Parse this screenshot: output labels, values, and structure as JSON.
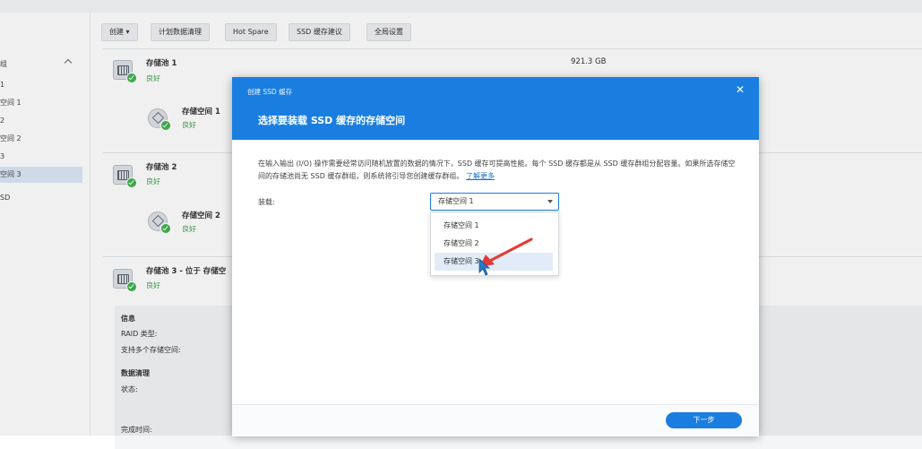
{
  "sidebar": {
    "items": [
      {
        "label": "组"
      },
      {
        "label": "1"
      },
      {
        "label": "空间 1"
      },
      {
        "label": "2"
      },
      {
        "label": "空间 2"
      },
      {
        "label": "3"
      },
      {
        "label": "空间 3"
      },
      {
        "label": "SD"
      }
    ]
  },
  "toolbar": {
    "create_label": "创建 ▾",
    "schedule_label": "计划数据清理",
    "hotspare_label": "Hot Spare",
    "ssd_advice_label": "SSD 缓存建议",
    "global_label": "全局设置"
  },
  "pools": [
    {
      "name": "存储池 1",
      "status": "良好",
      "size": "921.3 GB",
      "volume": {
        "name": "存储空间 1",
        "status": "良好"
      }
    },
    {
      "name": "存储池 2",
      "status": "良好",
      "volume": {
        "name": "存储空间 2",
        "status": "良好"
      }
    },
    {
      "name": "存储池 3 - 位于 存储空",
      "status": "良好"
    }
  ],
  "info": {
    "section_info": "信息",
    "raid": "RAID 类型:",
    "multi": "支持多个存储空间:",
    "section_scrub": "数据清理",
    "state": "状态:",
    "done": "完成时间:"
  },
  "dialog": {
    "small_title": "创建 SSD 缓存",
    "title": "选择要装载 SSD 缓存的存储空间",
    "close_glyph": "✕",
    "desc": "在输入输出 (I/O) 操作需要经常访问随机放置的数据的情况下，SSD 缓存可提高性能。每个 SSD 缓存都是从 SSD 缓存群组分配容量。如果所选存储空间的存储池尚无 SSD 缓存群组，则系统将引导您创建缓存群组。",
    "learn_more": "了解更多",
    "field_label": "装载:",
    "selected": "存储空间 1",
    "options": [
      "存储空间 1",
      "存储空间 2",
      "存储空间 3"
    ],
    "next_label": "下一步"
  },
  "colors": {
    "accent": "#1a7ee0",
    "ok": "#3fb34f",
    "arrow": "#e53935"
  }
}
